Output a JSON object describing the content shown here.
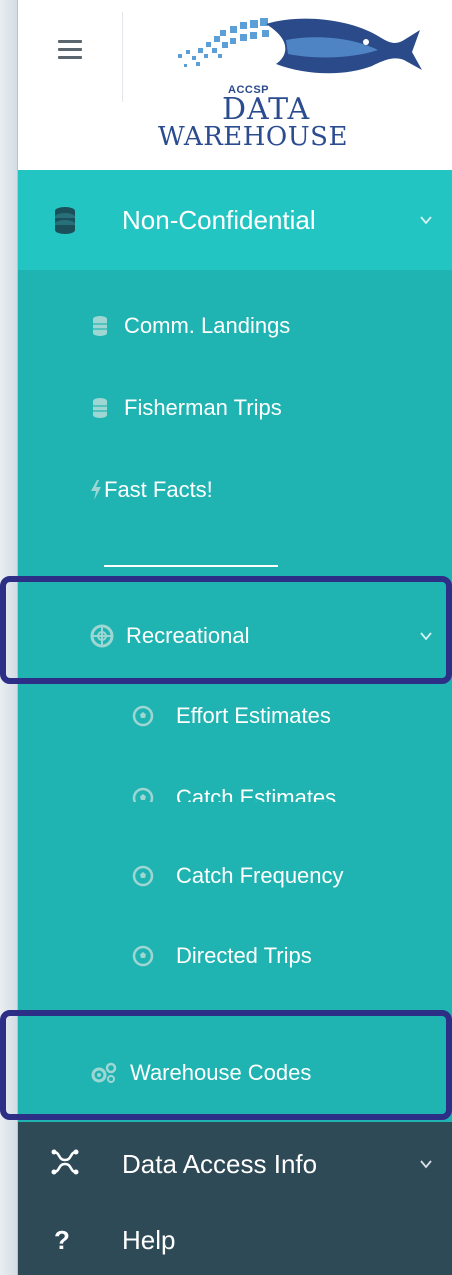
{
  "header": {
    "logo": {
      "accsp": "ACCSP",
      "data": "DATA",
      "warehouse": "WAREHOUSE"
    }
  },
  "menu": {
    "non_confidential": {
      "label": "Non-Confidential",
      "icon": "database-icon",
      "expanded": true,
      "items": [
        {
          "label": "Comm. Landings",
          "icon": "database-icon"
        },
        {
          "label": "Fisherman Trips",
          "icon": "database-icon"
        },
        {
          "label": "Fast Facts!",
          "icon": "bolt-icon"
        }
      ],
      "separator": "______________"
    },
    "recreational": {
      "label": "Recreational",
      "icon": "lifebuoy-icon",
      "expanded": true,
      "items": [
        {
          "label": "Effort Estimates",
          "icon": "soccer-ball-icon"
        },
        {
          "label": "Catch Estimates",
          "icon": "soccer-ball-icon"
        },
        {
          "label": "Catch Frequency",
          "icon": "soccer-ball-icon"
        },
        {
          "label": "Directed Trips",
          "icon": "soccer-ball-icon"
        }
      ]
    },
    "warehouse_codes": {
      "label": "Warehouse Codes",
      "icon": "gears-icon"
    },
    "data_access_info": {
      "label": "Data Access Info",
      "icon": "sitemap-icon"
    },
    "help": {
      "label": "Help",
      "icon": "question-icon"
    }
  },
  "colors": {
    "teal": "#1fb4b2",
    "teal_header": "#23c5c2",
    "dark": "#2f4a57",
    "highlight": "#2d2f86"
  }
}
